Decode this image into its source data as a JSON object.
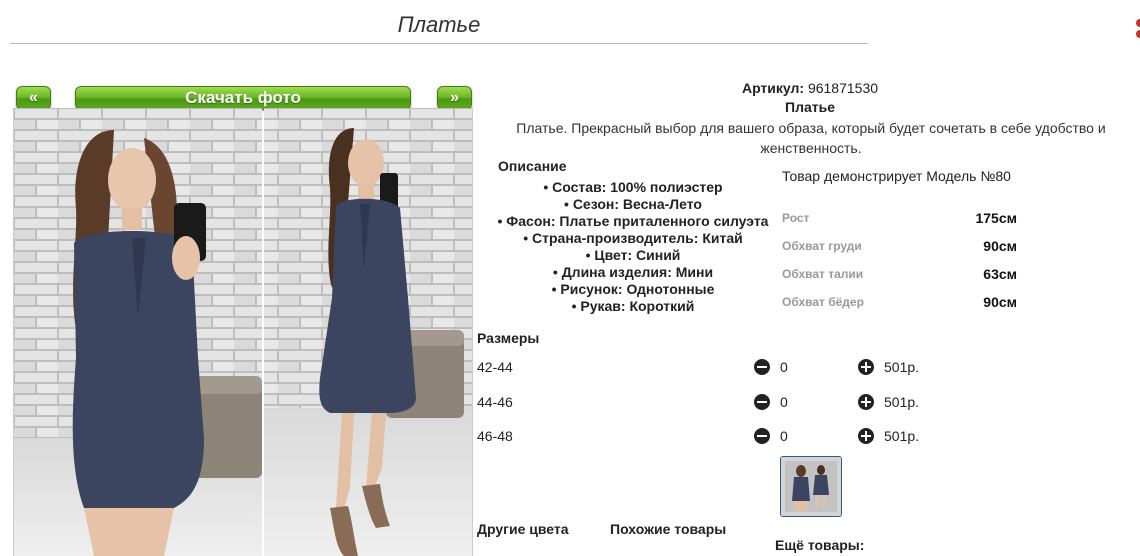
{
  "page": {
    "title": "Платье"
  },
  "gallery": {
    "prev_label": "«",
    "download_label": "Скачать фото",
    "next_label": "»"
  },
  "product": {
    "article_label": "Артикул:",
    "article_value": "961871530",
    "name": "Платье",
    "description": "Платье. Прекрасный выбор для вашего образа, который будет сочетать в себе удобство и женственность."
  },
  "specs": {
    "heading": "Описание",
    "items": [
      "• Состав: 100% полиэстер",
      "• Сезон: Весна-Лето",
      "• Фасон: Платье приталенного силуэта",
      "• Страна-производитель: Китай",
      "• Цвет: Синий",
      "• Длина изделия: Мини",
      "• Рисунок: Однотонные",
      "• Рукав: Короткий"
    ]
  },
  "model": {
    "line": "Товар демонстрирует Модель №80",
    "measurements": [
      {
        "label": "Рост",
        "value": "175см"
      },
      {
        "label": "Обхват груди",
        "value": "90см"
      },
      {
        "label": "Обхват талии",
        "value": "63см"
      },
      {
        "label": "Обхват бёдер",
        "value": "90см"
      }
    ]
  },
  "sizes": {
    "heading": "Размеры",
    "rows": [
      {
        "size": "42-44",
        "qty": "0",
        "price": "501р."
      },
      {
        "size": "44-46",
        "qty": "0",
        "price": "501р."
      },
      {
        "size": "46-48",
        "qty": "0",
        "price": "501р."
      }
    ]
  },
  "sections": {
    "other_colors": "Другие цвета",
    "similar": "Похожие товары",
    "more": "Ещё товары:"
  },
  "colors": {
    "button_green": "#6fb92a",
    "dress_navy": "#3a4560",
    "brick_gray": "#c9c9c9"
  }
}
